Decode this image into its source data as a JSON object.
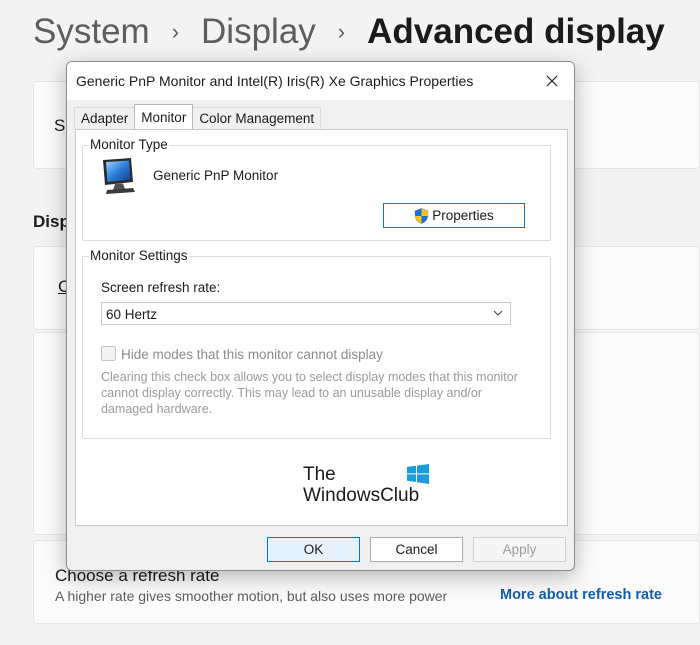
{
  "breadcrumb": {
    "items": [
      "System",
      "Display",
      "Advanced display"
    ],
    "separator": "›"
  },
  "background": {
    "peek_s": "S",
    "peek_disp": "Disp",
    "peek_c": "C",
    "refresh_title": "Choose a refresh rate",
    "refresh_desc": "A higher rate gives smoother motion, but also uses more power",
    "refresh_link": "More about refresh rate"
  },
  "dialog": {
    "title": "Generic PnP Monitor and Intel(R) Iris(R) Xe Graphics Properties",
    "tabs": [
      {
        "label": "Adapter",
        "active": false
      },
      {
        "label": "Monitor",
        "active": true
      },
      {
        "label": "Color Management",
        "active": false
      }
    ],
    "monitor_type": {
      "legend": "Monitor Type",
      "name": "Generic PnP Monitor",
      "properties_label": "Properties"
    },
    "monitor_settings": {
      "legend": "Monitor Settings",
      "refresh_label": "Screen refresh rate:",
      "refresh_value": "60 Hertz",
      "hide_modes_label": "Hide modes that this monitor cannot display",
      "hide_modes_checked": false,
      "help_text": "Clearing this check box allows you to select display modes that this monitor cannot display correctly. This may lead to an unusable display and/or damaged hardware."
    },
    "watermark": {
      "line1": "The",
      "line2": "WindowsClub"
    },
    "buttons": {
      "ok": "OK",
      "cancel": "Cancel",
      "apply": "Apply"
    }
  },
  "colors": {
    "accent": "#0078d4",
    "link": "#0e5eae",
    "window_bg": "#f0f0f0",
    "page_bg": "#f3f3f3"
  }
}
